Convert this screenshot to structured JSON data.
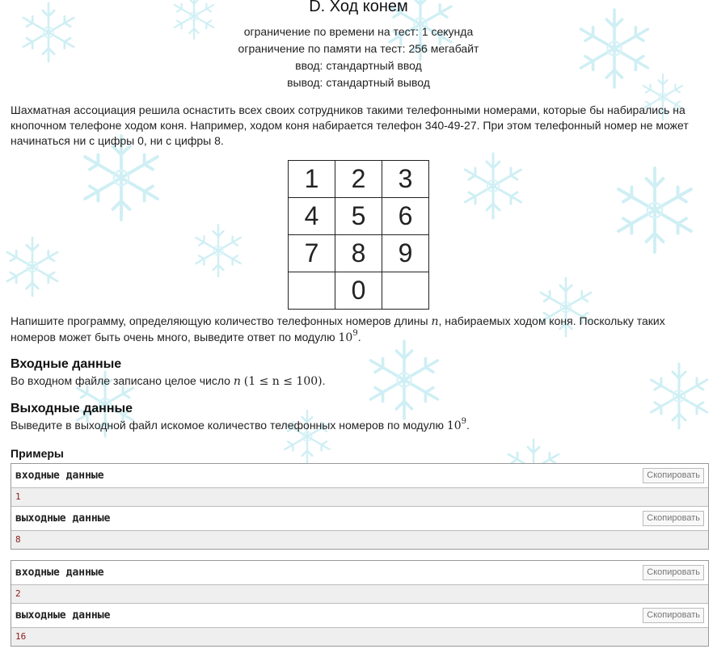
{
  "problem": {
    "title": "D. Ход конем",
    "limits": [
      "ограничение по времени на тест: 1 секунда",
      "ограничение по памяти на тест: 256 мегабайт",
      "ввод: стандартный ввод",
      "вывод: стандартный вывод"
    ],
    "statement": {
      "line1": "Шахматная ассоциация решила оснастить всех своих сотрудников такими телефонными номерами, которые бы набирались на",
      "line2": "кнопочном телефоне ходом коня. Например, ходом коня набирается телефон 340-49-27. При этом телефонный номер не может",
      "line3": "начинаться ни с цифры 0, ни с цифры 8."
    },
    "keypad": [
      [
        "1",
        "2",
        "3"
      ],
      [
        "4",
        "5",
        "6"
      ],
      [
        "7",
        "8",
        "9"
      ],
      [
        "",
        "0",
        ""
      ]
    ],
    "task": {
      "line1_a": "Напишите программу, определяющую количество телефонных номеров длины ",
      "var_n": "n",
      "line1_b": ", набираемых ходом коня. Поскольку таких",
      "line2_a": "номеров может быть очень много, выведите ответ по модулю ",
      "mod_base": "10",
      "mod_exp": "9",
      "line2_b": "."
    },
    "input_section": {
      "title": "Входные данные",
      "text_a": "Во входном файле записано целое число ",
      "var_n": "n",
      "constraint": "(1 ≤ n ≤ 100)",
      "text_b": "."
    },
    "output_section": {
      "title": "Выходные данные",
      "text_a": "Выведите в выходной файл искомое количество телефонных номеров по модулю ",
      "mod_base": "10",
      "mod_exp": "9",
      "text_b": "."
    },
    "examples_title": "Примеры",
    "copy_label": "Скопировать",
    "input_label": "входные данные",
    "output_label": "выходные данные",
    "examples": [
      {
        "input": "1",
        "output": "8"
      },
      {
        "input": "2",
        "output": "16"
      }
    ]
  },
  "colors": {
    "snowflake": "#d4f1f6",
    "sample_value": "#8b1a1a"
  },
  "background": "snowflake-pattern"
}
